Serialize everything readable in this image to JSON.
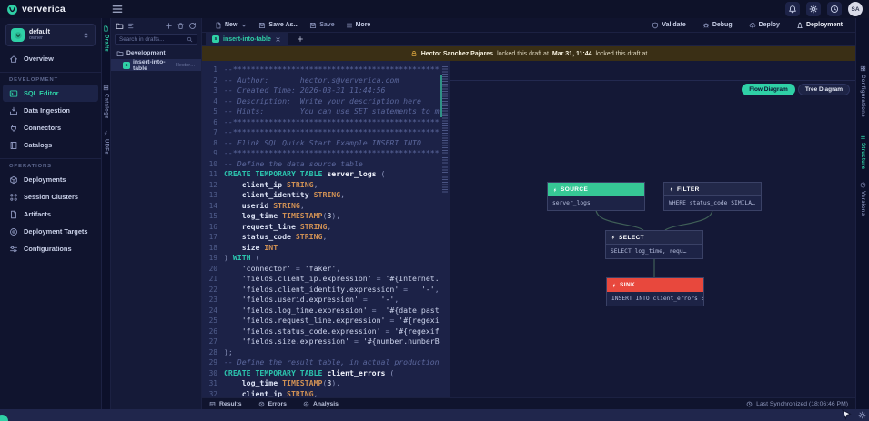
{
  "colors": {
    "accent_teal": "#2fd0a6",
    "source_green": "#36c795",
    "sink_red": "#e8483d",
    "lock_banner_bg": "#3a2f15",
    "editor_bg": "#1c2247",
    "panel_bg": "#10142e"
  },
  "topbar": {
    "brand": "ververica",
    "avatar": "SA"
  },
  "workspace": {
    "name": "default",
    "role": "owner"
  },
  "sidebar": {
    "sections": [
      {
        "label": "",
        "items": [
          {
            "icon": "home",
            "label": "Overview"
          }
        ]
      },
      {
        "label": "DEVELOPMENT",
        "items": [
          {
            "icon": "sql-editor",
            "label": "SQL Editor",
            "active": true
          },
          {
            "icon": "data-ingestion",
            "label": "Data Ingestion"
          },
          {
            "icon": "connectors",
            "label": "Connectors"
          },
          {
            "icon": "catalogs",
            "label": "Catalogs"
          }
        ]
      },
      {
        "label": "OPERATIONS",
        "items": [
          {
            "icon": "deployments",
            "label": "Deployments"
          },
          {
            "icon": "session-clusters",
            "label": "Session Clusters"
          },
          {
            "icon": "artifacts",
            "label": "Artifacts"
          },
          {
            "icon": "deployment-targets",
            "label": "Deployment Targets"
          },
          {
            "icon": "configurations",
            "label": "Configurations"
          }
        ]
      }
    ]
  },
  "left_rail": [
    {
      "icon": "file",
      "label": "Drafts",
      "active": true
    },
    {
      "icon": "grid",
      "label": "Catalogs"
    },
    {
      "icon": "udf",
      "label": "UDFs"
    }
  ],
  "right_rail": [
    {
      "icon": "grid",
      "label": "Configurations"
    },
    {
      "icon": "structure",
      "label": "Structure",
      "active": true
    },
    {
      "icon": "history",
      "label": "Versions"
    }
  ],
  "drafts_panel": {
    "search_placeholder": "Search in drafts...",
    "folder": "Development",
    "draft": {
      "badge": "s",
      "name": "insert-into-table",
      "owner": "Hector S..."
    }
  },
  "toolbar": {
    "left": [
      {
        "icon": "file",
        "label": "New",
        "chevron": true
      },
      {
        "icon": "save",
        "label": "Save As..."
      },
      {
        "icon": "save",
        "label": "Save",
        "dim": true
      },
      {
        "icon": "more",
        "label": "More"
      }
    ],
    "right": [
      {
        "icon": "shield",
        "label": "Validate"
      },
      {
        "icon": "debug",
        "label": "Debug"
      },
      {
        "icon": "deploy",
        "label": "Deploy"
      },
      {
        "icon": "rocket",
        "label": "Deployment",
        "bright": true
      }
    ]
  },
  "tab": {
    "label": "insert-into-table"
  },
  "lock_banner": {
    "user": "Hector Sanchez Pajares",
    "mid": "locked this draft at",
    "time": "Mar 31, 11:44",
    "tail": "locked this draft at"
  },
  "editor": {
    "lines": [
      [
        [
          "c",
          "--**************************************************"
        ]
      ],
      [
        [
          "c",
          "-- Author:       hector.s@ververica.com"
        ]
      ],
      [
        [
          "c",
          "-- Created Time: 2026-03-31 11:44:56"
        ]
      ],
      [
        [
          "c",
          "-- Description:  Write your description here"
        ]
      ],
      [
        [
          "c",
          "-- Hints:        You can use SET statements to m"
        ]
      ],
      [
        [
          "c",
          "--**************************************************"
        ]
      ],
      [
        [
          "c",
          "--**************************************************"
        ]
      ],
      [
        [
          "c",
          "-- Flink SQL Quick Start Example INSERT INTO"
        ]
      ],
      [
        [
          "c",
          "--**************************************************"
        ]
      ],
      [
        [
          "c",
          "-- Define the data source table"
        ]
      ],
      [
        [
          "k",
          "CREATE TEMPORARY TABLE"
        ],
        [
          "b",
          " server_logs"
        ],
        [
          "o",
          " ("
        ]
      ],
      [
        [
          "i",
          "    client_ip "
        ],
        [
          "t",
          "STRING"
        ],
        [
          "o",
          ","
        ]
      ],
      [
        [
          "i",
          "    client_identity "
        ],
        [
          "t",
          "STRING"
        ],
        [
          "o",
          ","
        ]
      ],
      [
        [
          "i",
          "    userid "
        ],
        [
          "t",
          "STRING"
        ],
        [
          "o",
          ","
        ]
      ],
      [
        [
          "i",
          "    log_time "
        ],
        [
          "t",
          "TIMESTAMP"
        ],
        [
          "o",
          "("
        ],
        [
          "n",
          "3"
        ],
        [
          "o",
          "),"
        ]
      ],
      [
        [
          "i",
          "    request_line "
        ],
        [
          "t",
          "STRING"
        ],
        [
          "o",
          ","
        ]
      ],
      [
        [
          "i",
          "    status_code "
        ],
        [
          "t",
          "STRING"
        ],
        [
          "o",
          ","
        ]
      ],
      [
        [
          "i",
          "    size "
        ],
        [
          "t",
          "INT"
        ]
      ],
      [
        [
          "o",
          ") "
        ],
        [
          "k",
          "WITH"
        ],
        [
          "o",
          " ("
        ]
      ],
      [
        [
          "s",
          "    'connector'"
        ],
        [
          "o",
          " = "
        ],
        [
          "s",
          "'faker'"
        ],
        [
          "o",
          ","
        ]
      ],
      [
        [
          "s",
          "    'fields.client_ip.expression'"
        ],
        [
          "o",
          " = "
        ],
        [
          "s",
          "'#{Internet.pu"
        ]
      ],
      [
        [
          "s",
          "    'fields.client_identity.expression'"
        ],
        [
          "o",
          " =   "
        ],
        [
          "s",
          "'-'"
        ],
        [
          "o",
          ","
        ]
      ],
      [
        [
          "s",
          "    'fields.userid.expression'"
        ],
        [
          "o",
          " =   "
        ],
        [
          "s",
          "'-'"
        ],
        [
          "o",
          ","
        ]
      ],
      [
        [
          "s",
          "    'fields.log_time.expression'"
        ],
        [
          "o",
          " =  "
        ],
        [
          "s",
          "'#{date.past '"
        ]
      ],
      [
        [
          "s",
          "    'fields.request_line.expression'"
        ],
        [
          "o",
          " = "
        ],
        [
          "s",
          "'#{regexify"
        ]
      ],
      [
        [
          "s",
          "    'fields.status_code.expression'"
        ],
        [
          "o",
          " = "
        ],
        [
          "s",
          "'#{regexify"
        ]
      ],
      [
        [
          "s",
          "    'fields.size.expression'"
        ],
        [
          "o",
          " = "
        ],
        [
          "s",
          "'#{number.numberBet"
        ]
      ],
      [
        [
          "o",
          ");"
        ]
      ],
      [
        [
          "c",
          "-- Define the result table, in actual production w"
        ]
      ],
      [
        [
          "k",
          "CREATE TEMPORARY TABLE"
        ],
        [
          "b",
          " client_errors"
        ],
        [
          "o",
          " ("
        ]
      ],
      [
        [
          "i",
          "    log_time "
        ],
        [
          "t",
          "TIMESTAMP"
        ],
        [
          "o",
          "("
        ],
        [
          "n",
          "3"
        ],
        [
          "o",
          "),"
        ]
      ],
      [
        [
          "i",
          "    client_ip "
        ],
        [
          "t",
          "STRING"
        ],
        [
          "o",
          ","
        ]
      ]
    ]
  },
  "diagram": {
    "toggles": [
      {
        "label": "Flow Diagram",
        "active": true
      },
      {
        "label": "Tree Diagram",
        "active": false
      }
    ],
    "nodes": [
      {
        "kind": "source",
        "title": "SOURCE",
        "body": "server_logs"
      },
      {
        "kind": "filter",
        "title": "FILTER",
        "body": "WHERE status_code SIMILA…"
      },
      {
        "kind": "select",
        "title": "SELECT",
        "body": "SELECT log_time, requ…"
      },
      {
        "kind": "sink",
        "title": "SINK",
        "body": "INSERT INTO client_errors S…"
      }
    ]
  },
  "status_bar": {
    "tabs": [
      {
        "icon": "results",
        "label": "Results"
      },
      {
        "icon": "errors",
        "label": "Errors"
      },
      {
        "icon": "analysis",
        "label": "Analysis"
      }
    ],
    "sync": "Last Synchronized  (18:06:46 PM)"
  }
}
